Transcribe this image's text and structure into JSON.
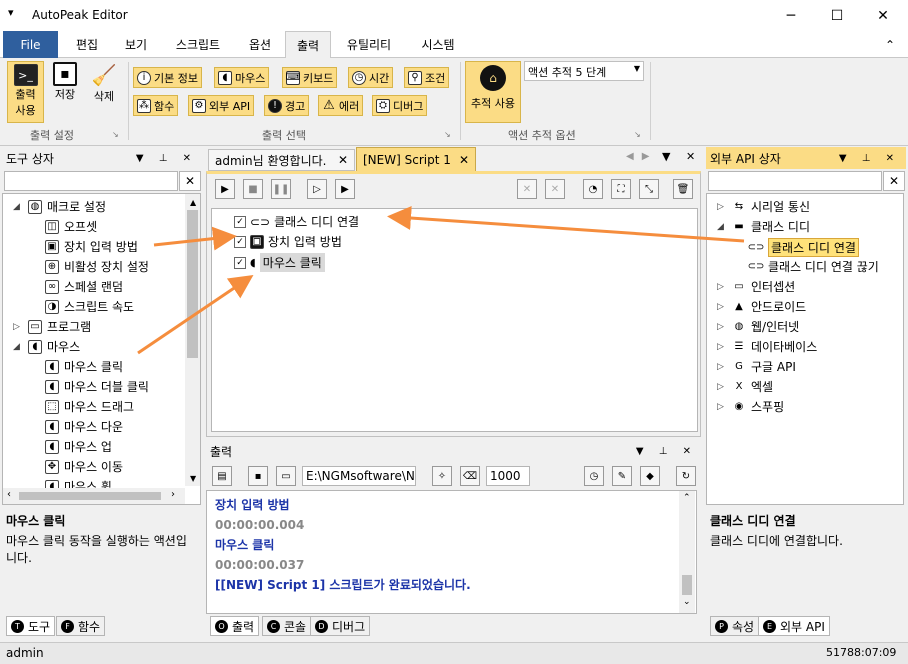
{
  "window": {
    "title": "AutoPeak Editor",
    "minimize": "─",
    "maximize": "☐",
    "close": "✕",
    "quick_access": "▾"
  },
  "menu": {
    "tabs": [
      "File",
      "편집",
      "보기",
      "스크립트",
      "옵션",
      "출력",
      "유틸리티",
      "시스템"
    ],
    "active": "출력",
    "collapse_icon": "⌃"
  },
  "ribbon": {
    "group1": {
      "label": "출력 설정",
      "buttons": [
        {
          "label1": "출력",
          "label2": "사용"
        },
        {
          "label1": "저장"
        },
        {
          "label1": "삭제"
        }
      ]
    },
    "group2": {
      "label": "출력 선택",
      "row1": [
        "기본 정보",
        "마우스",
        "키보드",
        "시간",
        "조건"
      ],
      "row2": [
        "함수",
        "외부 API",
        "경고",
        "에러",
        "디버그"
      ]
    },
    "group3": {
      "label": "액션 추적 옵션",
      "track_button": "추적 사용",
      "combo_value": "액션 추적 5 단계"
    }
  },
  "toolbox": {
    "title": "도구 상자",
    "search_value": "",
    "clear": "✕",
    "tree": [
      {
        "label": "매크로 설정",
        "level": 0,
        "expand": "◢"
      },
      {
        "label": "오프셋",
        "level": 1
      },
      {
        "label": "장치 입력 방법",
        "level": 1
      },
      {
        "label": "비활성 장치 설정",
        "level": 1
      },
      {
        "label": "스페셜 랜덤",
        "level": 1
      },
      {
        "label": "스크립트 속도",
        "level": 1
      },
      {
        "label": "프로그램",
        "level": 0,
        "expand": "▷"
      },
      {
        "label": "마우스",
        "level": 0,
        "expand": "◢"
      },
      {
        "label": "마우스 클릭",
        "level": 1
      },
      {
        "label": "마우스 더블 클릭",
        "level": 1
      },
      {
        "label": "마우스 드래그",
        "level": 1
      },
      {
        "label": "마우스 다운",
        "level": 1
      },
      {
        "label": "마우스 업",
        "level": 1
      },
      {
        "label": "마우스 이동",
        "level": 1
      },
      {
        "label": "마우스 휠",
        "level": 1
      }
    ],
    "desc_title": "마우스 클릭",
    "desc_text": "마우스 클릭 동작을 실행하는 액션입니다.",
    "tabs": [
      {
        "icon": "T",
        "label": "도구"
      },
      {
        "icon": "F",
        "label": "함수"
      }
    ]
  },
  "editor": {
    "tabs": [
      {
        "label": "admin님 환영합니다.",
        "close": "✕"
      },
      {
        "label": "[NEW] Script 1",
        "close": "✕"
      }
    ],
    "script": [
      {
        "label": "클래스 디디 연결",
        "checked": true
      },
      {
        "label": "장치 입력 방법",
        "checked": true
      },
      {
        "label": "마우스 클릭",
        "checked": true
      }
    ]
  },
  "output": {
    "title": "출력",
    "path": "E:\\NGMsoftware\\NG",
    "count": "1000",
    "lines": [
      {
        "text": "장치 입력 방법",
        "style": "blue"
      },
      {
        "text": "00:00:00.004",
        "style": "gray"
      },
      {
        "text": "마우스 클릭",
        "style": "blue"
      },
      {
        "text": "00:00:00.037",
        "style": "gray"
      },
      {
        "text": "[[NEW] Script 1] 스크립트가 완료되었습니다.",
        "style": "blue"
      }
    ],
    "tabs": [
      {
        "icon": "O",
        "label": "출력"
      },
      {
        "icon": "C",
        "label": "콘솔"
      },
      {
        "icon": "D",
        "label": "디버그"
      }
    ]
  },
  "api": {
    "title": "외부 API 상자",
    "search_value": "",
    "clear": "✕",
    "tree": [
      {
        "label": "시리얼 통신",
        "level": 0,
        "expand": "▷"
      },
      {
        "label": "클래스 디디",
        "level": 0,
        "expand": "◢"
      },
      {
        "label": "클래스 디디 연결",
        "level": 1,
        "selected": true
      },
      {
        "label": "클래스 디디 연결 끊기",
        "level": 1
      },
      {
        "label": "인터셉션",
        "level": 0,
        "expand": "▷"
      },
      {
        "label": "안드로이드",
        "level": 0,
        "expand": "▷"
      },
      {
        "label": "웹/인터넷",
        "level": 0,
        "expand": "▷"
      },
      {
        "label": "데이타베이스",
        "level": 0,
        "expand": "▷"
      },
      {
        "label": "구글 API",
        "level": 0,
        "expand": "▷"
      },
      {
        "label": "엑셀",
        "level": 0,
        "expand": "▷"
      },
      {
        "label": "스푸핑",
        "level": 0,
        "expand": "▷"
      }
    ],
    "desc_title": "클래스 디디 연결",
    "desc_text": "클래스 디디에 연결합니다.",
    "tabs": [
      {
        "icon": "P",
        "label": "속성"
      },
      {
        "icon": "E",
        "label": "외부 API"
      }
    ]
  },
  "status": {
    "user": "admin",
    "time": "51788:07:09"
  },
  "colors": {
    "accent": "#2f5f9e",
    "ribbon_button": "#fbdc85",
    "highlight": "#ffe27a",
    "arrow": "#f58d3d",
    "output_blue": "#1c34a8"
  }
}
